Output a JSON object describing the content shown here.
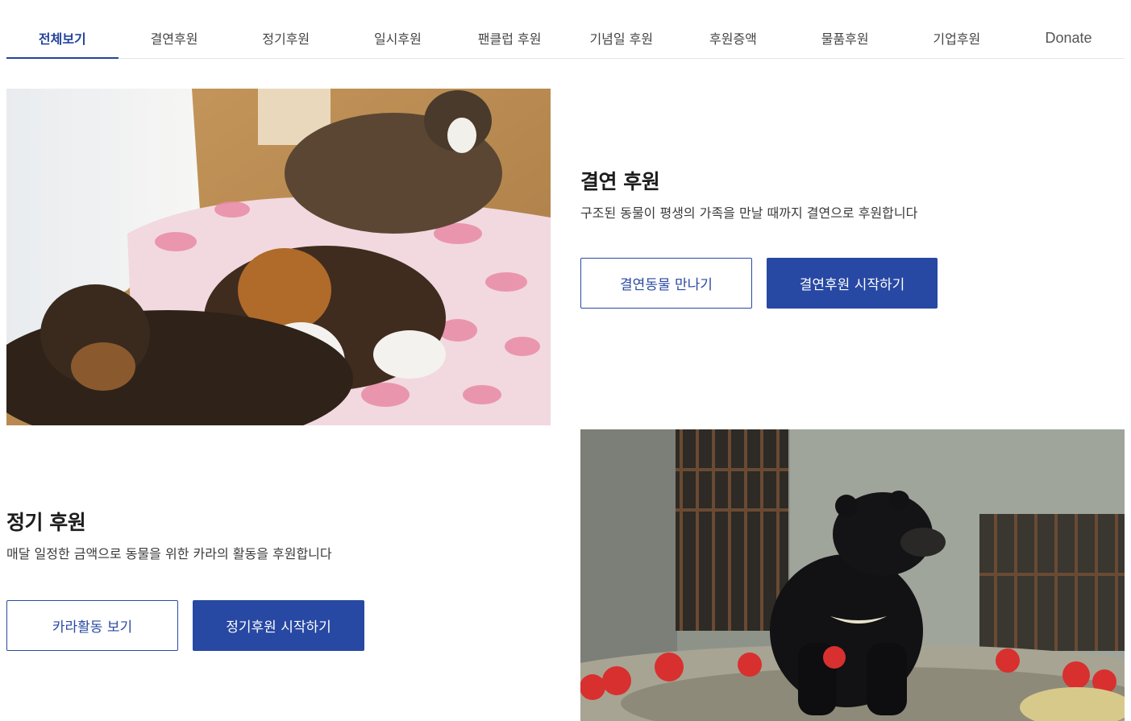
{
  "tabs": [
    {
      "label": "전체보기",
      "active": true
    },
    {
      "label": "결연후원"
    },
    {
      "label": "정기후원"
    },
    {
      "label": "일시후원"
    },
    {
      "label": "팬클럽 후원"
    },
    {
      "label": "기념일 후원"
    },
    {
      "label": "후원증액"
    },
    {
      "label": "물품후원"
    },
    {
      "label": "기업후원"
    },
    {
      "label": "Donate"
    }
  ],
  "sections": [
    {
      "title": "결연 후원",
      "description": "구조된 동물이 평생의 가족을 만날 때까지 결연으로 후원합니다",
      "secondary_button": "결연동물 만나기",
      "primary_button": "결연후원 시작하기"
    },
    {
      "title": "정기 후원",
      "description": "매달 일정한 금액으로 동물을 위한 카라의 활동을 후원합니다",
      "secondary_button": "카라활동 보기",
      "primary_button": "정기후원 시작하기"
    }
  ],
  "colors": {
    "accent": "#2748a3",
    "text": "#1d1d1d"
  }
}
